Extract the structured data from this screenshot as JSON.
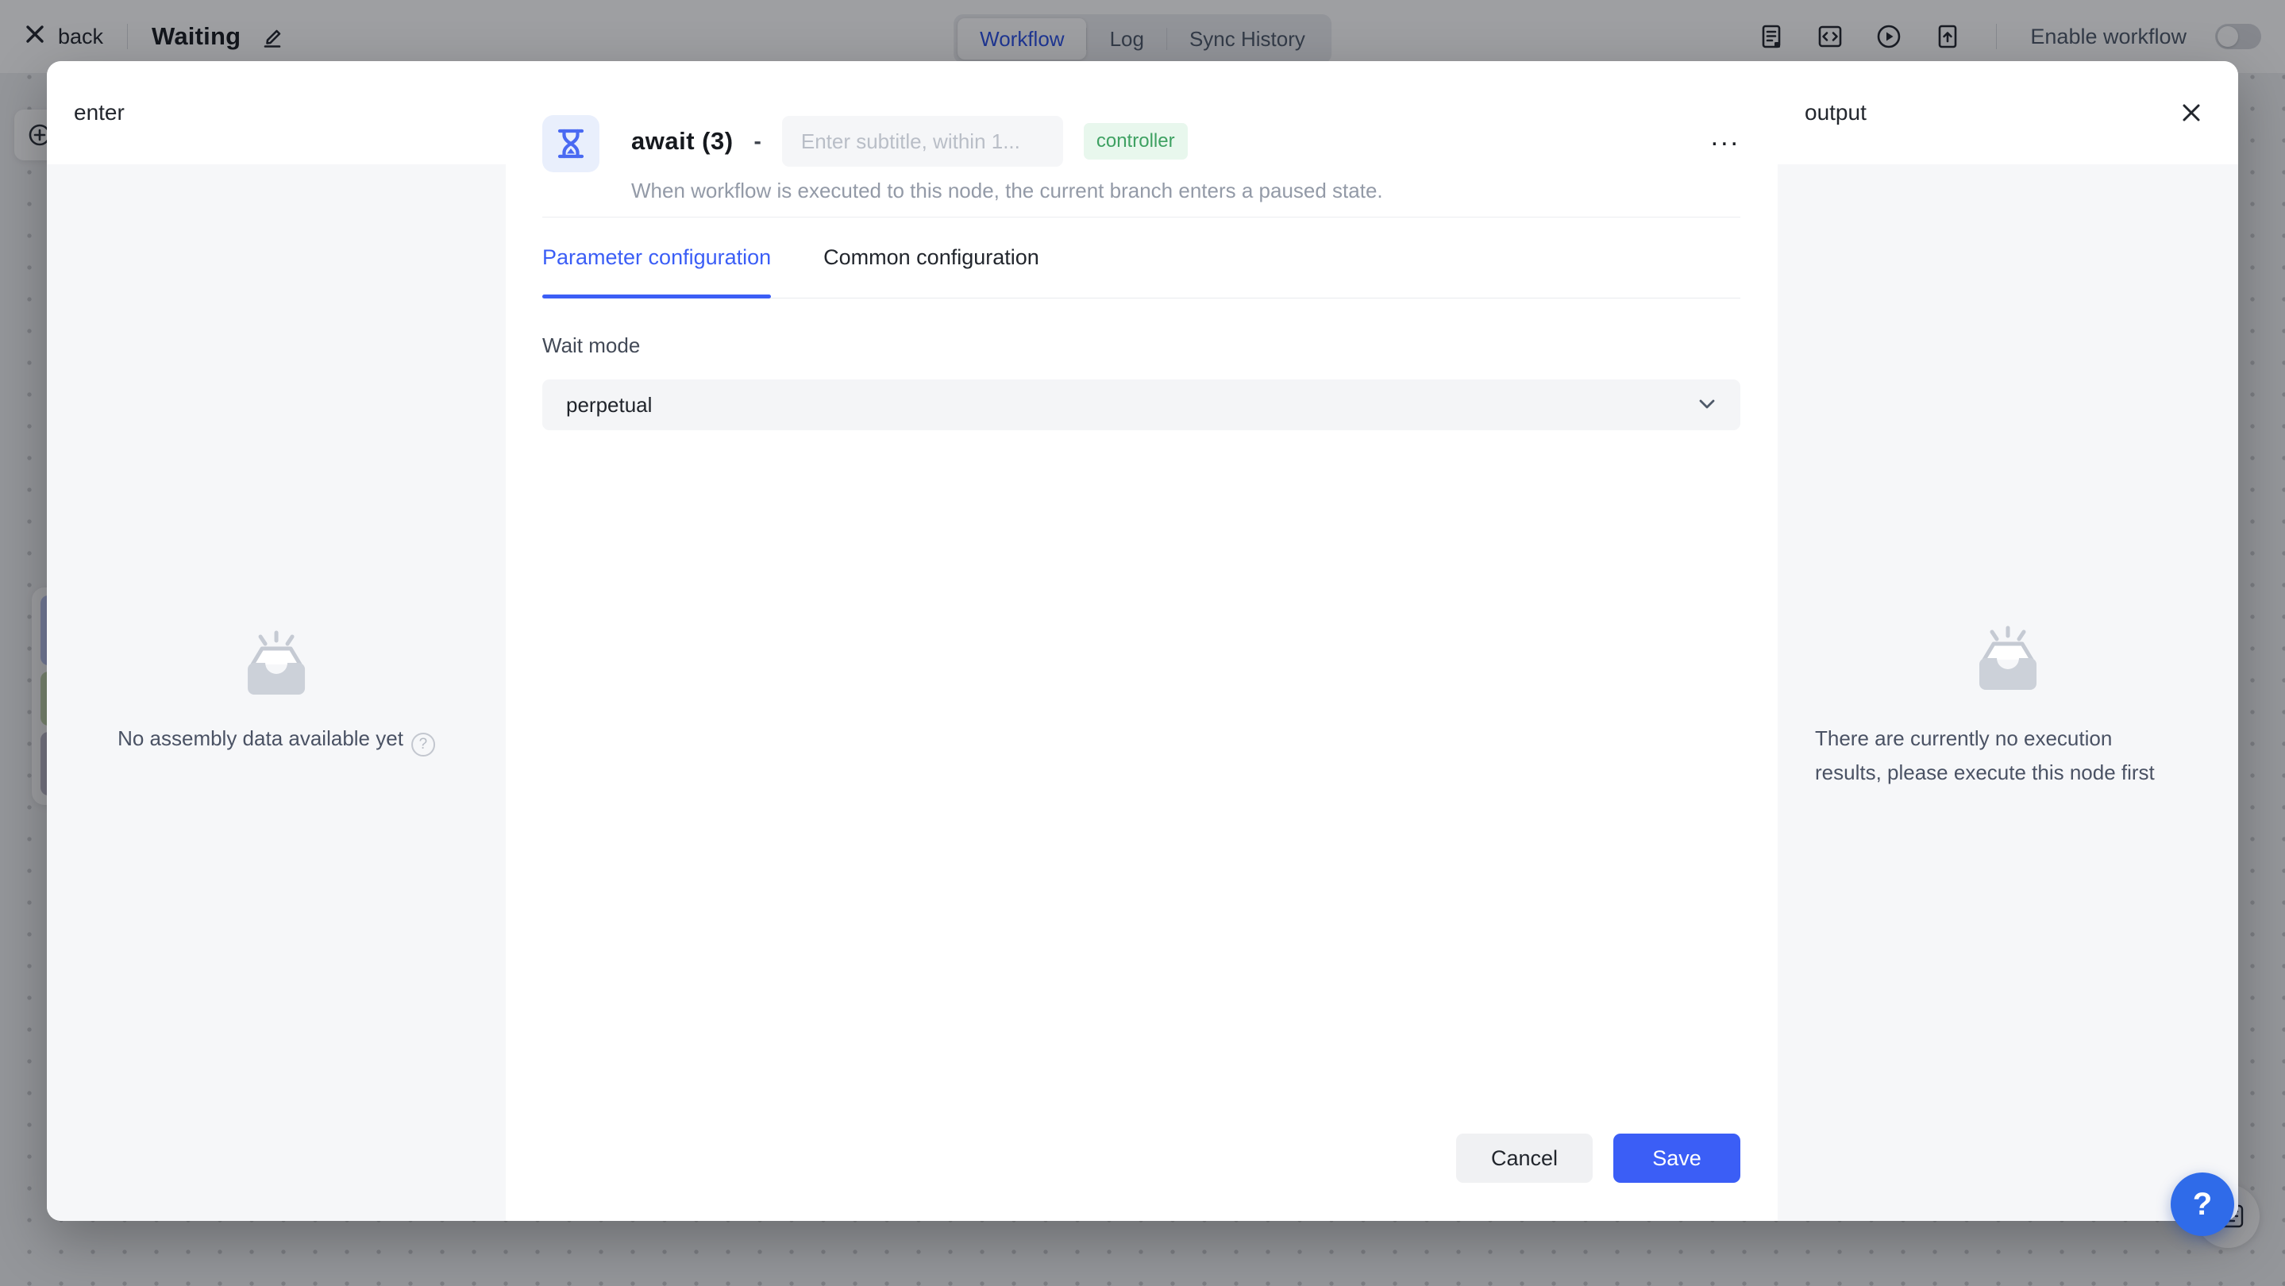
{
  "topbar": {
    "back_label": "back",
    "workflow_title": "Waiting",
    "tabs": [
      {
        "label": "Workflow",
        "active": true
      },
      {
        "label": "Log",
        "active": false
      },
      {
        "label": "Sync History",
        "active": false
      }
    ],
    "action_icons": [
      "template-doc-icon",
      "code-icon",
      "run-play-icon",
      "publish-file-icon"
    ],
    "enable_workflow_label": "Enable workflow",
    "enable_workflow_on": false
  },
  "modal": {
    "left_panel": {
      "title": "enter",
      "empty_text": "No assembly data available yet",
      "help_icon": "?"
    },
    "node": {
      "icon": "hourglass-icon",
      "title": "await (3)",
      "separator": "-",
      "subtitle_placeholder": "Enter subtitle, within 1...",
      "badge": "controller",
      "description": "When workflow is executed to this node, the current branch enters a paused state.",
      "more_label": "..."
    },
    "config_tabs": [
      {
        "label": "Parameter configuration",
        "active": true
      },
      {
        "label": "Common configuration",
        "active": false
      }
    ],
    "form": {
      "wait_mode_label": "Wait mode",
      "wait_mode_value": "perpetual"
    },
    "footer": {
      "cancel_label": "Cancel",
      "save_label": "Save"
    },
    "right_panel": {
      "title": "output",
      "empty_text_lines": [
        "There are currently no execution",
        "results, please execute this node first"
      ]
    }
  },
  "fab": {
    "help_label": "?"
  },
  "colors": {
    "accent_blue": "#3b5ef6",
    "active_tab_blue": "#2b50e4",
    "badge_green_text": "#3ea162",
    "badge_green_bg": "#e8f7ed",
    "node_icon_blue": "#4a6af2",
    "node_icon_bg": "#e9effc",
    "fab_blue": "#2f6be9",
    "panel_gray": "#f6f7f9",
    "overlay": "rgba(13,16,22,0.40)"
  }
}
